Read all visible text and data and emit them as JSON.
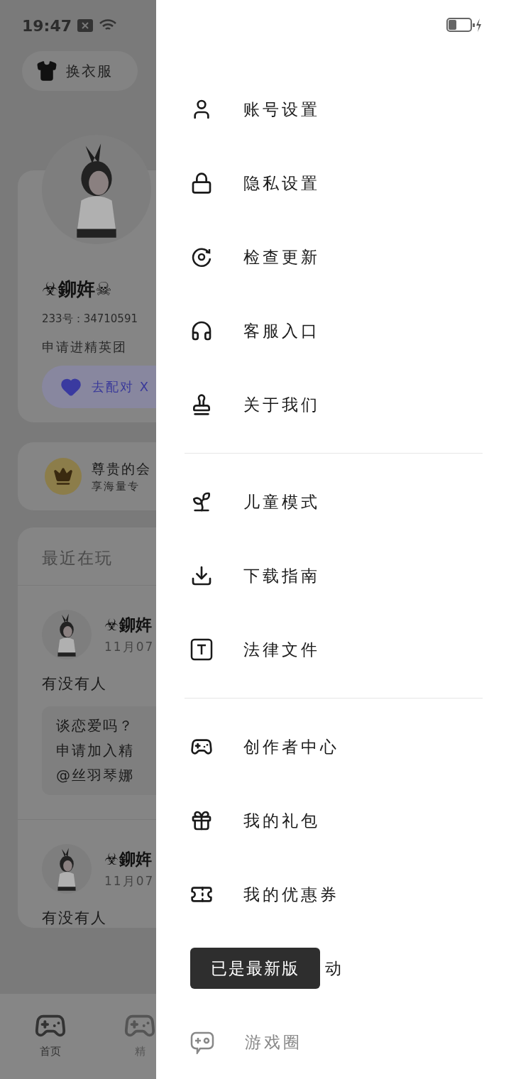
{
  "status_bar": {
    "time": "19:47"
  },
  "background_page": {
    "outfit_button": "换衣服",
    "profile": {
      "name": "☣鉚姩☠",
      "id_line": "233号：34710591",
      "motto": "申请进精英团",
      "pair_button": "去配对",
      "pair_extra": "X"
    },
    "vip_card": {
      "title": "尊贵的会",
      "subtitle": "享海量专"
    },
    "recent": {
      "title": "最近在玩",
      "posts": [
        {
          "author": "☣鉚姩",
          "date": "11月07",
          "text": "有没有人",
          "quote": [
            "谈恋爱吗？",
            "申请加入精",
            "@丝羽琴娜"
          ]
        },
        {
          "author": "☣鉚姩",
          "date": "11月07",
          "text": "有没有人"
        }
      ]
    },
    "bottom_nav": [
      {
        "label": "首页",
        "selected": true
      },
      {
        "label": "精",
        "selected": false
      }
    ]
  },
  "drawer": {
    "groups": [
      {
        "items": [
          {
            "label": "账号设置",
            "kind": "normal"
          },
          {
            "label": "隐私设置",
            "kind": "normal"
          },
          {
            "label": "检查更新",
            "kind": "normal"
          },
          {
            "label": "客服入口",
            "kind": "normal"
          },
          {
            "label": "关于我们",
            "kind": "normal"
          }
        ]
      },
      {
        "items": [
          {
            "label": "儿童模式",
            "kind": "normal"
          },
          {
            "label": "下载指南",
            "kind": "normal"
          },
          {
            "label": "法律文件",
            "kind": "normal"
          }
        ]
      },
      {
        "items": [
          {
            "label": "创作者中心",
            "kind": "normal"
          },
          {
            "label": "我的礼包",
            "kind": "normal"
          },
          {
            "label": "我的优惠券",
            "kind": "normal"
          },
          {
            "label": "动",
            "kind": "covered"
          },
          {
            "label": "游戏圈",
            "kind": "fading"
          }
        ]
      }
    ],
    "toast": "已是最新版"
  }
}
